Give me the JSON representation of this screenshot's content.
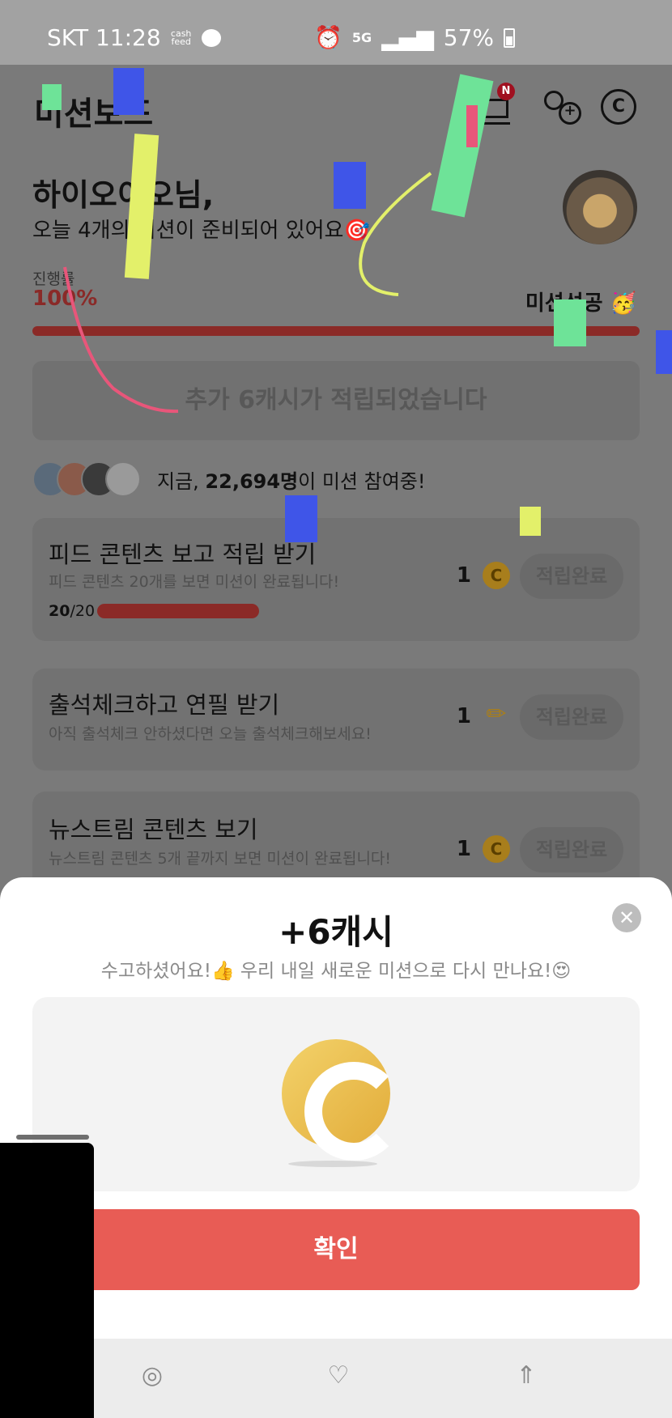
{
  "status_bar": {
    "carrier_time": "SKT 11:28",
    "cash_feed": "cash feed",
    "network": "5G",
    "battery": "57%"
  },
  "header": {
    "title": "미션보드",
    "cart_badge": "N",
    "cash_icon_letter": "C"
  },
  "greeting": {
    "hello": "하이오이오님,",
    "subtitle": "오늘 4개의 미션이 준비되어 있어요🎯"
  },
  "progress": {
    "label": "진행률",
    "value": "100%",
    "status": "미션성공 🥳",
    "fraction": 1.0
  },
  "extra_banner": "추가 6캐시가 적립되었습니다",
  "participants": {
    "prefix": "지금, ",
    "count": "22,694명",
    "suffix": "이 미션 참여중!"
  },
  "missions": [
    {
      "title": "피드 콘텐츠 보고 적립 받기",
      "desc": "피드 콘텐츠 20개를 보면 미션이 완료됩니다!",
      "reward": "1",
      "reward_icon": "coin-icon",
      "button": "적립완료",
      "progress_done": "20",
      "progress_total": "/20"
    },
    {
      "title": "출석체크하고 연필 받기",
      "desc": "아직 출석체크 안하셨다면 오늘 출석체크해보세요!",
      "reward": "1",
      "reward_icon": "pencil-icon",
      "button": "적립완료"
    },
    {
      "title": "뉴스트림 콘텐츠 보기",
      "desc": "뉴스트림 콘텐츠 5개 끝까지 보면 미션이 완료됩니다!",
      "reward": "1",
      "reward_icon": "coin-icon",
      "button": "적립완료"
    }
  ],
  "sheet": {
    "title": "+6캐시",
    "subtitle": "수고하셨어요!👍 우리 내일 새로운 미션으로 다시 만나요!😍",
    "confirm": "확인",
    "close": "✕"
  },
  "colors": {
    "accent_red": "#e85c55",
    "progress_red": "#8b2a27",
    "coin_gold": "#e2ac3a"
  }
}
